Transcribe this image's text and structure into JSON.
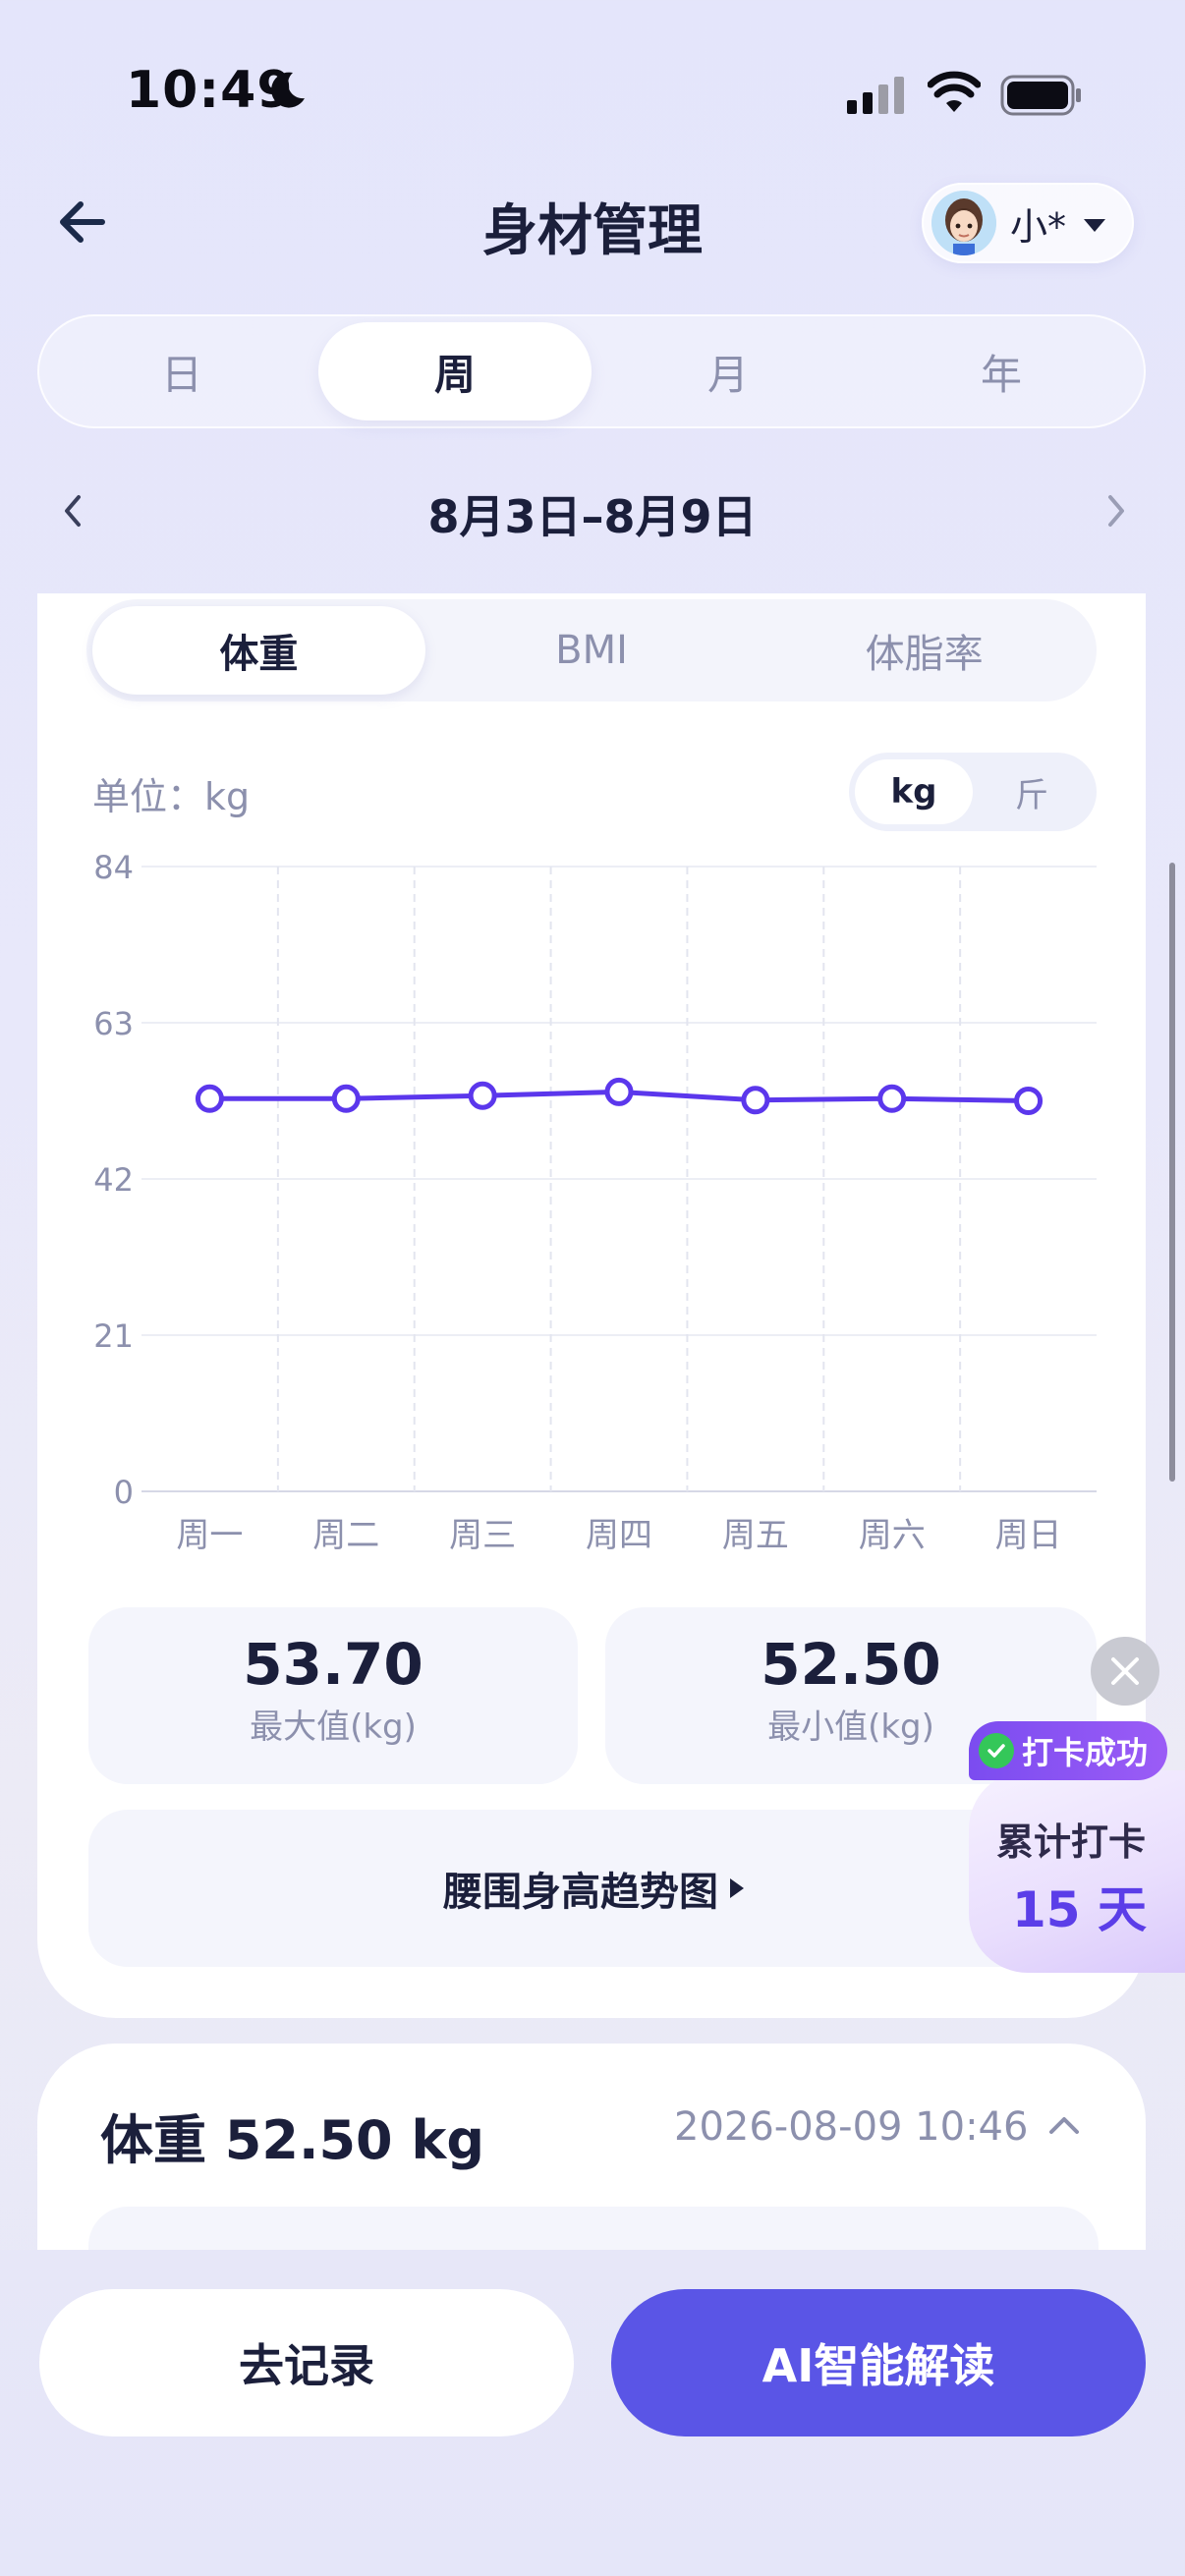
{
  "status_bar": {
    "time": "10:49"
  },
  "header": {
    "title": "身材管理",
    "user_name": "小*"
  },
  "period_tabs": [
    {
      "label": "日",
      "active": false
    },
    {
      "label": "周",
      "active": true
    },
    {
      "label": "月",
      "active": false
    },
    {
      "label": "年",
      "active": false
    }
  ],
  "date_range": "8月3日–8月9日",
  "metric_tabs": [
    {
      "label": "体重",
      "active": true
    },
    {
      "label": "BMI",
      "active": false
    },
    {
      "label": "体脂率",
      "active": false
    }
  ],
  "unit": {
    "label": "单位：kg",
    "options": [
      "kg",
      "斤"
    ],
    "selected": "kg"
  },
  "colors": {
    "accent": "#5a55e6",
    "line": "#5b37ec",
    "text": "#1b1f3b",
    "muted": "#8c90ad"
  },
  "chart_data": {
    "type": "line",
    "categories": [
      "周一",
      "周二",
      "周三",
      "周四",
      "周五",
      "周六",
      "周日"
    ],
    "series": [
      {
        "values": [
          52.8,
          52.8,
          53.2,
          53.7,
          52.6,
          52.8,
          52.5
        ]
      }
    ],
    "yticks": [
      "84",
      "63",
      "42",
      "21",
      "0"
    ],
    "ylim": [
      0,
      84
    ],
    "grid": true
  },
  "stats": {
    "max": {
      "value": "53.70",
      "label": "最大值(kg)"
    },
    "min": {
      "value": "52.50",
      "label": "最小值(kg)"
    }
  },
  "trend_link": "腰围身高趋势图",
  "badge": {
    "pill": "打卡成功",
    "line1": "累计打卡",
    "line2": "15 天"
  },
  "record": {
    "title": "体重 52.50 kg",
    "timestamp": "2026-08-09 10:46"
  },
  "actions": {
    "record": "去记录",
    "ai": "AI智能解读"
  }
}
